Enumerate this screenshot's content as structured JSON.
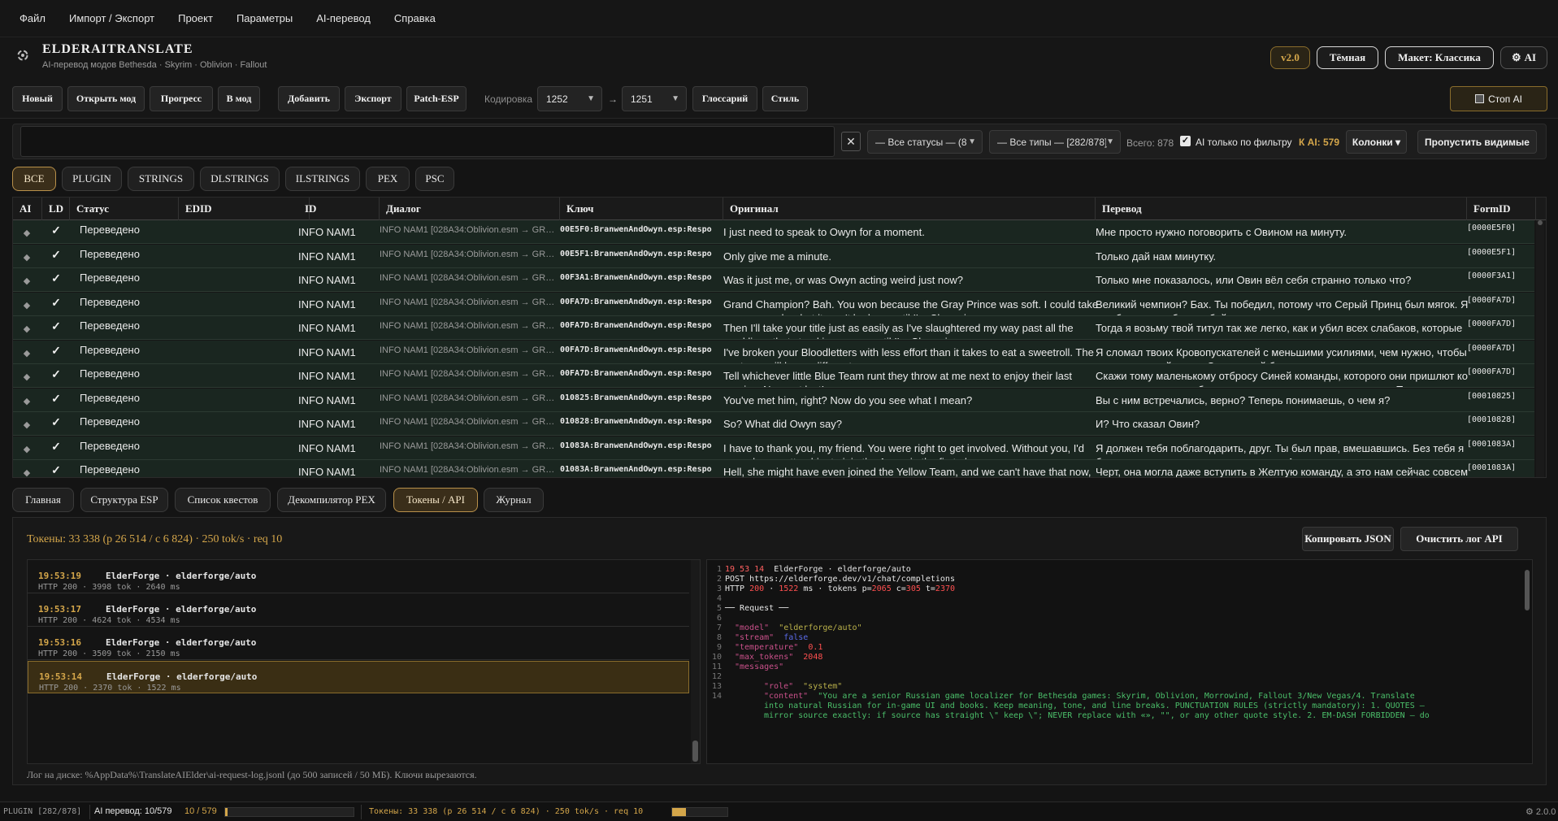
{
  "menu": [
    "Файл",
    "Импорт / Экспорт",
    "Проект",
    "Параметры",
    "AI-перевод",
    "Справка"
  ],
  "app": {
    "title": "ELDERAITRANSLATE",
    "subtitle": "AI-перевод модов Bethesda · Skyrim · Oblivion · Fallout",
    "version_badge": "v2.0",
    "theme_label": "Тёмная",
    "layout_label": "Макет: Классика",
    "ai_label": "AI"
  },
  "toolbar": {
    "new": "Новый",
    "open_mod": "Открыть мод",
    "progress": "Прогресс",
    "to_mod": "В мод",
    "add": "Добавить",
    "export": "Экспорт",
    "patch_esp": "Patch-ESP",
    "encoding_label": "Кодировка",
    "encoding_from": "1252",
    "arrow": "→",
    "encoding_to": "1251",
    "glossary": "Глоссарий",
    "style": "Стиль",
    "stop_ai": "Стоп AI"
  },
  "filter": {
    "search_value": "",
    "clear": "✕",
    "status_select": "— Все статусы — (8",
    "type_select": "— Все типы — [282/878]",
    "total": "Всего: 878",
    "ai_only_label": "AI только по фильтру",
    "ai_only_checked": true,
    "k_ai": "К AI: 579",
    "columns": "Колонки ▾",
    "skip_visible": "Пропустить видимые"
  },
  "type_tabs": [
    "ВСЕ",
    "PLUGIN",
    "STRINGS",
    "DLSTRINGS",
    "ILSTRINGS",
    "PEX",
    "PSC"
  ],
  "type_tab_active": 0,
  "table": {
    "headers": {
      "ai": "AI",
      "ld": "LD",
      "status": "Статус",
      "edid": "EDID",
      "id": "ID",
      "dialog": "Диалог",
      "key": "Ключ",
      "orig": "Оригинал",
      "trans": "Перевод",
      "form": "FormID"
    },
    "rows": [
      {
        "ai": "◆",
        "ld": "✓",
        "status": "Переведено",
        "id": "INFO NAM1",
        "dialog": "INFO NAM1  [028A34:Oblivion.esm → GREE...",
        "key": "00E5F0:BranwenAndOwyn.esp:Respo",
        "orig": "I just need to speak to Owyn for a moment.",
        "trans": "Мне просто нужно поговорить с Овином на минуту.",
        "form": "[0000E5F0]"
      },
      {
        "ai": "◆",
        "ld": "✓",
        "status": "Переведено",
        "id": "INFO NAM1",
        "dialog": "INFO NAM1  [028A34:Oblivion.esm → GREE...",
        "key": "00E5F1:BranwenAndOwyn.esp:Respo",
        "orig": "Only give me a minute.",
        "trans": "Только дай нам минутку.",
        "form": "[0000E5F1]"
      },
      {
        "ai": "◆",
        "ld": "✓",
        "status": "Переведено",
        "id": "INFO NAM1",
        "dialog": "INFO NAM1  [028A34:Oblivion.esm → GREE...",
        "key": "00F3A1:BranwenAndOwyn.esp:Respo",
        "orig": "Was it just me, or was Owyn acting weird just now?",
        "trans": "Только мне показалось, или Овин вёл себя странно только что?",
        "form": "[0000F3A1]"
      },
      {
        "ai": "◆",
        "ld": "✓",
        "status": "Переведено",
        "id": "INFO NAM1",
        "dialog": "INFO NAM1  [028A34:Oblivion.esm → GREE...",
        "key": "00FA7D:BranwenAndOwyn.esp:Respo",
        "orig": "Grand Champion? Bah. You won because the Gray Prince was soft. I could take you on any day, but it won't be long until I'm Champion.",
        "trans": "Великий чемпион? Бах. Ты победил, потому что Серый Принц был мягок. Я мог бы взять тебя в любой день, и скоро я стану чемпионом.",
        "form": "[0000FA7D]"
      },
      {
        "ai": "◆",
        "ld": "✓",
        "status": "Переведено",
        "id": "INFO NAM1",
        "dialog": "INFO NAM1  [028A34:Oblivion.esm → GREE...",
        "key": "00FA7D:BranwenAndOwyn.esp:Respo",
        "orig": "Then I'll take your title just as easily as I've slaughtered my way past all the weaklings that stood in my way until I'm Champion.",
        "trans": "Тогда я возьму твой титул так же легко, как и убил всех слабаков, которые стояли у меня на пути, пока не стал чемпионом.",
        "form": "[0000FA7D]"
      },
      {
        "ai": "◆",
        "ld": "✓",
        "status": "Переведено",
        "id": "INFO NAM1",
        "dialog": "INFO NAM1  [028A34:Oblivion.esm → GREE...",
        "key": "00FA7D:BranwenAndOwyn.esp:Respo",
        "orig": "I've broken your Bloodletters with less effort than it takes to eat a sweetroll. The next one will be no different.",
        "trans": "Я сломал твоих Кровопускателей с меньшими усилиями, чем нужно, чтобы съесть сладкий рулет. Следующий будет таким же.",
        "form": "[0000FA7D]"
      },
      {
        "ai": "◆",
        "ld": "✓",
        "status": "Переведено",
        "id": "INFO NAM1",
        "dialog": "INFO NAM1  [028A34:Oblivion.esm → GREE...",
        "key": "00FA7D:BranwenAndOwyn.esp:Respo",
        "orig": "Tell whichever little Blue Team runt they throw at me next to enjoy their last sunrise. Now get lost!",
        "trans": "Скажи тому маленькому отбросу Синей команды, которого они пришлют ко мне следующим, чтобы наслаждался последним рассветом. Теперь проваливай!",
        "form": "[0000FA7D]"
      },
      {
        "ai": "◆",
        "ld": "✓",
        "status": "Переведено",
        "id": "INFO NAM1",
        "dialog": "INFO NAM1  [028A34:Oblivion.esm → GREE...",
        "key": "010825:BranwenAndOwyn.esp:Respo",
        "orig": "You've met him, right? Now do you see what I mean?",
        "trans": "Вы с ним встречались, верно? Теперь понимаешь, о чем я?",
        "form": "[00010825]"
      },
      {
        "ai": "◆",
        "ld": "✓",
        "status": "Переведено",
        "id": "INFO NAM1",
        "dialog": "INFO NAM1  [028A34:Oblivion.esm → GREE...",
        "key": "010828:BranwenAndOwyn.esp:Respo",
        "orig": "So? What did Owyn say?",
        "trans": "И? Что сказал Овин?",
        "form": "[00010828]"
      },
      {
        "ai": "◆",
        "ld": "✓",
        "status": "Переведено",
        "id": "INFO NAM1",
        "dialog": "INFO NAM1  [028A34:Oblivion.esm → GREE...",
        "key": "01083A:BranwenAndOwyn.esp:Respo",
        "orig": "I have to thank you, my friend. You were right to get involved. Without you, I'd never have gotten him to join the Arena in the first place.",
        "trans": "Я должен тебя поблагодарить, друг. Ты был прав, вмешавшись. Без тебя я бы никогда не уговорил его вступить в Арену изначально.",
        "form": "[0001083A]"
      },
      {
        "ai": "◆",
        "ld": "✓",
        "status": "Переведено",
        "id": "INFO NAM1",
        "dialog": "INFO NAM1  [028A34:Oblivion.esm → GREE...",
        "key": "01083A:BranwenAndOwyn.esp:Respo",
        "orig": "Hell, she might have even joined the Yellow Team, and we can't have that now, can we?",
        "trans": "Черт, она могла даже вступить в Желтую команду, а это нам сейчас совсем ни к чему, правда?",
        "form": "[0001083A]"
      }
    ]
  },
  "bottom_tabs": [
    "Главная",
    "Структура ESP",
    "Список квестов",
    "Декомпилятор PEX",
    "Токены / API",
    "Журнал"
  ],
  "bottom_tab_active": 4,
  "tokens": {
    "summary": "Токены: 33 338 (p 26 514 / c 6 824) · 250 tok/s · req 10",
    "copy_json": "Копировать JSON",
    "clear_log": "Очистить лог API",
    "requests": [
      {
        "time": "19:53:19",
        "source": "ElderForge  ·  elderforge/auto",
        "meta": "HTTP 200  · 3998 tok  · 2640 ms"
      },
      {
        "time": "19:53:17",
        "source": "ElderForge  ·  elderforge/auto",
        "meta": "HTTP 200  · 4624 tok  · 4534 ms"
      },
      {
        "time": "19:53:16",
        "source": "ElderForge  ·  elderforge/auto",
        "meta": "HTTP 200  · 3509 tok  · 2150 ms"
      },
      {
        "time": "19:53:14",
        "source": "ElderForge  ·  elderforge/auto",
        "meta": "HTTP 200  · 2370 tok  · 1522 ms"
      }
    ],
    "active_request": 3,
    "json": {
      "l1_time": "19 53 14",
      "l1_rest": "  ElderForge · elderforge/auto",
      "l2": "POST https://elderforge.dev/v1/chat/completions",
      "l3_a": "HTTP ",
      "l3_status": "200",
      "l3_b": " · ",
      "l3_ms": "1522",
      "l3_c": " ms · tokens p=",
      "l3_p": "2065",
      "l3_d": " c=",
      "l3_c_val": "305",
      "l3_e": " t=",
      "l3_t": "2370",
      "l5": "── Request ──",
      "k_model": "\"model\"",
      "v_model": "  \"elderforge/auto\"",
      "k_stream": "\"stream\"",
      "v_stream": "  false",
      "k_temp": "\"temperature\"",
      "v_temp": "  0.1",
      "k_max": "\"max_tokens\"",
      "v_max": "  2048",
      "k_messages": "\"messages\"",
      "k_role": "\"role\"",
      "v_role": "  \"system\"",
      "k_content": "\"content\"",
      "v_content_1": "  \"You are a senior Russian game localizer for Bethesda games: Skyrim, Oblivion, Morrowind, Fallout 3/New Vegas/4. Translate",
      "v_content_2": "into natural Russian for in-game UI and books. Keep meaning, tone, and line breaks. PUNCTUATION RULES (strictly mandatory): 1. QUOTES —",
      "v_content_3": "mirror source exactly: if source has straight \\\" keep \\\"; NEVER replace with «», \"\", or any other quote style. 2. EM-DASH FORBIDDEN — do"
    },
    "log_path": "Лог на диске: %AppData%\\TranslateAIElder\\ai-request-log.jsonl (до 500 записей / 50 МБ). Ключи вырезаются."
  },
  "statusbar": {
    "plugin": "PLUGIN [282/878]",
    "ai_label": "AI перевод: 10/579",
    "ai_count": "10 / 579",
    "ai_progress": 0.017,
    "tokens": "Токены: 33 338 (p 26 514 / c 6 824) · 250 tok/s · req 10",
    "tok_progress": 0.25,
    "version": "2.0.0"
  }
}
